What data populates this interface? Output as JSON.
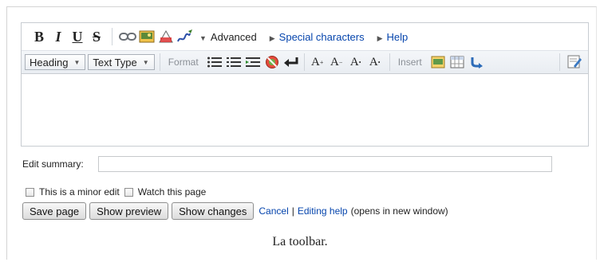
{
  "toolbar": {
    "bold_label": "B",
    "italic_label": "I",
    "underline_label": "U",
    "strike_label": "S",
    "advanced_label": "Advanced",
    "special_chars_label": "Special characters",
    "help_label": "Help",
    "heading_label": "Heading",
    "text_type_label": "Text Type",
    "format_group_label": "Format",
    "size_labels": [
      "A",
      "A",
      "A",
      "A"
    ],
    "insert_group_label": "Insert"
  },
  "form": {
    "summary_label": "Edit summary:",
    "summary_value": "",
    "minor_edit_label": "This is a minor edit",
    "watch_label": "Watch this page",
    "save_label": "Save page",
    "preview_label": "Show preview",
    "changes_label": "Show changes",
    "cancel_label": "Cancel",
    "separator": "|",
    "editing_help_label": "Editing help",
    "new_window_note": "(opens in new window)"
  },
  "caption": "La toolbar.",
  "colors": {
    "link": "#0645ad",
    "toolbar_bg": "#e9edf2",
    "border": "#c8ccd1"
  }
}
